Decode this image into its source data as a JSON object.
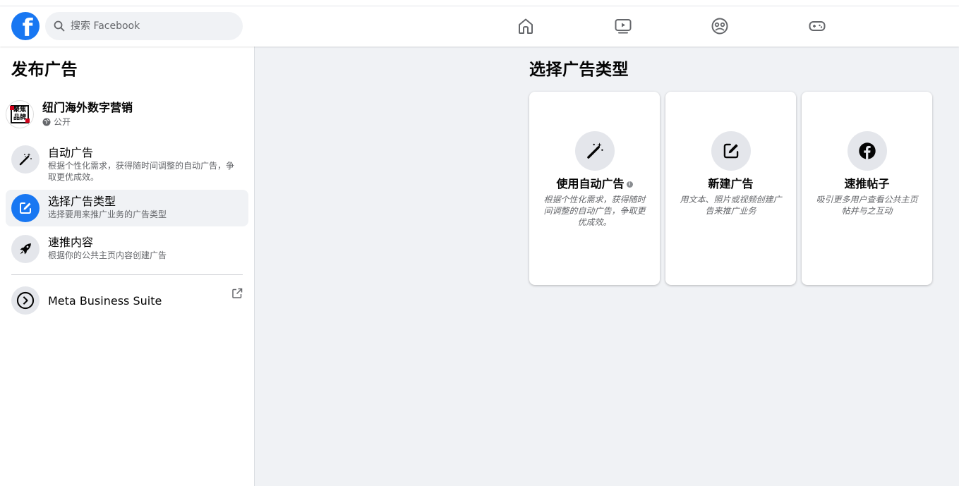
{
  "header": {
    "logo": "f",
    "search_placeholder": "搜索 Facebook",
    "nav_icons": [
      "home-icon",
      "watch-icon",
      "groups-icon",
      "gaming-icon"
    ]
  },
  "sidebar": {
    "title": "发布广告",
    "page": {
      "name": "纽门海外数字营销",
      "privacy": "公开",
      "avatar_text": [
        "聚",
        "焦",
        "品",
        "牌"
      ]
    },
    "items": [
      {
        "title": "自动广告",
        "subtitle": "根据个性化需求，获得随时间调整的自动广告，争取更优成效。",
        "icon": "magic-wand-icon"
      },
      {
        "title": "选择广告类型",
        "subtitle": "选择要用来推广业务的广告类型",
        "icon": "edit-icon"
      },
      {
        "title": "速推内容",
        "subtitle": "根据你的公共主页内容创建广告",
        "icon": "rocket-icon"
      }
    ],
    "meta_business_suite": "Meta Business Suite"
  },
  "main": {
    "title": "选择广告类型",
    "cards": [
      {
        "title": "使用自动广告",
        "desc": "根据个性化需求，获得随时间调整的自动广告，争取更优成效。",
        "icon": "magic-wand-icon"
      },
      {
        "title": "新建广告",
        "desc": "用文本、照片或视频创建广告来推广业务",
        "icon": "edit-icon"
      },
      {
        "title": "速推帖子",
        "desc": "吸引更多用户查看公共主页帖并与之互动",
        "icon": "facebook-icon"
      }
    ]
  },
  "colors": {
    "brand": "#1877f2",
    "background": "#f0f2f5",
    "secondary_text": "#65676b"
  }
}
